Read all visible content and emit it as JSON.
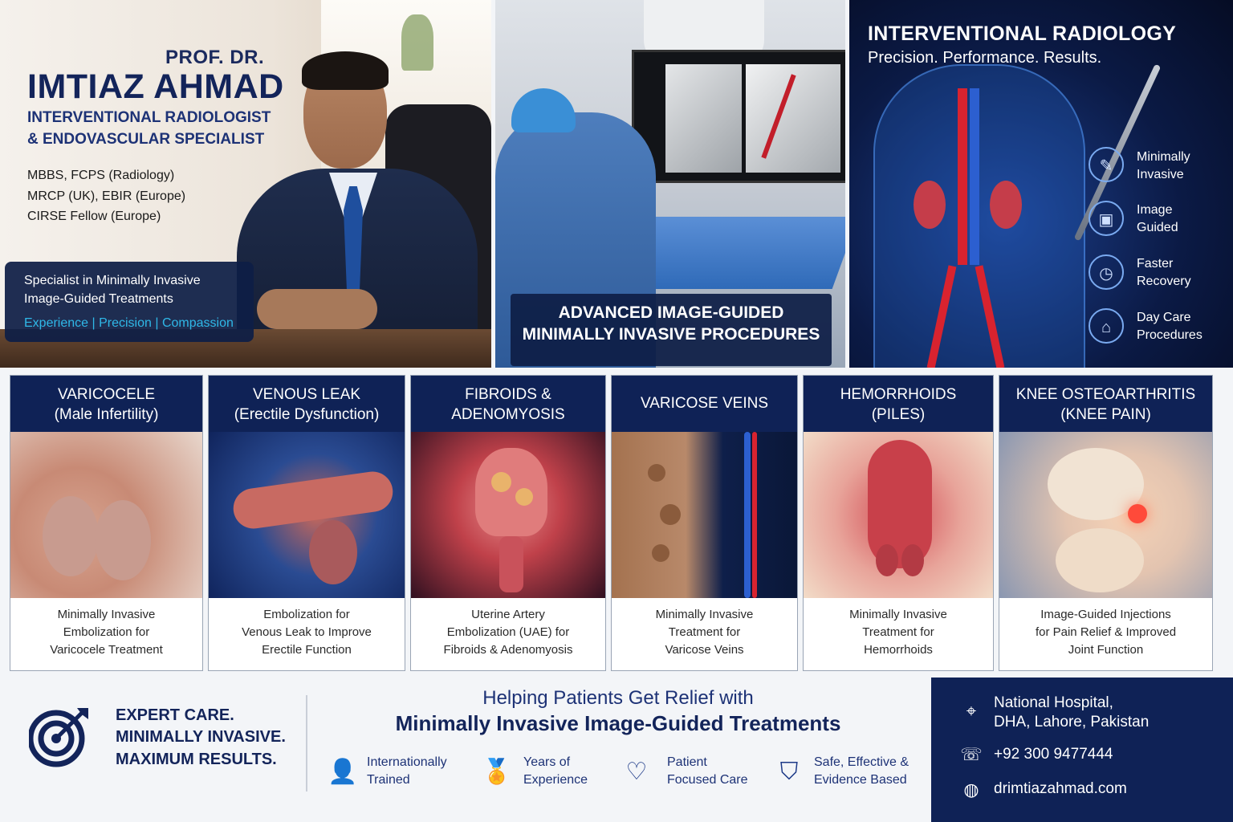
{
  "doctor": {
    "prefix": "PROF. DR.",
    "name": "IMTIAZ AHMAD",
    "role_line1": "INTERVENTIONAL RADIOLOGIST",
    "role_line2": "& ENDOVASCULAR SPECIALIST",
    "qualifications": [
      "MBBS, FCPS (Radiology)",
      "MRCP (UK), EBIR (Europe)",
      "CIRSE Fellow (Europe)"
    ],
    "specialty_line1": "Specialist in Minimally Invasive",
    "specialty_line2": "Image-Guided Treatments",
    "values": "Experience | Precision | Compassion"
  },
  "procedures_banner": {
    "line1": "ADVANCED IMAGE-GUIDED",
    "line2": "MINIMALLY INVASIVE PROCEDURES"
  },
  "ir": {
    "title": "INTERVENTIONAL RADIOLOGY",
    "subtitle": "Precision. Performance. Results.",
    "features": [
      {
        "icon": "catheter-icon",
        "glyph": "✎",
        "line1": "Minimally",
        "line2": "Invasive"
      },
      {
        "icon": "monitor-icon",
        "glyph": "▣",
        "line1": "Image",
        "line2": "Guided"
      },
      {
        "icon": "clock-icon",
        "glyph": "◷",
        "line1": "Faster",
        "line2": "Recovery"
      },
      {
        "icon": "home-icon",
        "glyph": "⌂",
        "line1": "Day Care",
        "line2": "Procedures"
      }
    ]
  },
  "cards": [
    {
      "id": "varicocele",
      "title1": "VARICOCELE",
      "title2": "(Male Infertility)",
      "cap1": "Minimally Invasive",
      "cap2": "Embolization for",
      "cap3": "Varicocele Treatment"
    },
    {
      "id": "venous",
      "title1": "VENOUS LEAK",
      "title2": "(Erectile Dysfunction)",
      "cap1": "Embolization for",
      "cap2": "Venous Leak to Improve",
      "cap3": "Erectile Function"
    },
    {
      "id": "fibroids",
      "title1": "FIBROIDS &",
      "title2": "ADENOMYOSIS",
      "cap1": "Uterine Artery",
      "cap2": "Embolization (UAE) for",
      "cap3": "Fibroids & Adenomyosis"
    },
    {
      "id": "varicose",
      "title1": "VARICOSE VEINS",
      "title2": "",
      "cap1": "Minimally Invasive",
      "cap2": "Treatment for",
      "cap3": "Varicose Veins"
    },
    {
      "id": "hemorrhoids",
      "title1": "HEMORRHOIDS",
      "title2": "(PILES)",
      "cap1": "Minimally Invasive",
      "cap2": "Treatment for",
      "cap3": "Hemorrhoids"
    },
    {
      "id": "knee",
      "title1": "KNEE OSTEOARTHRITIS",
      "title2": "(KNEE PAIN)",
      "cap1": "Image-Guided Injections",
      "cap2": "for Pain Relief & Improved",
      "cap3": "Joint Function"
    }
  ],
  "tagline": [
    "EXPERT CARE.",
    "MINIMALLY INVASIVE.",
    "MAXIMUM RESULTS."
  ],
  "help": {
    "line1": "Helping Patients Get Relief with",
    "line2": "Minimally Invasive Image-Guided Treatments"
  },
  "badges": [
    {
      "icon": "person-icon",
      "glyph": "👤",
      "line1": "Internationally",
      "line2": "Trained"
    },
    {
      "icon": "medal-icon",
      "glyph": "🏅",
      "line1": "Years of",
      "line2": "Experience"
    },
    {
      "icon": "heart-hand-icon",
      "glyph": "♡",
      "line1": "Patient",
      "line2": "Focused Care"
    },
    {
      "icon": "shield-check-icon",
      "glyph": "⛉",
      "line1": "Safe, Effective &",
      "line2": "Evidence Based"
    }
  ],
  "contact": {
    "address1": "National Hospital,",
    "address2": "DHA, Lahore, Pakistan",
    "phone": "+92 300 9477444",
    "website": "drimtiazahmad.com"
  },
  "colors": {
    "navy": "#0f2256",
    "accent": "#2fb8e8",
    "artery_red": "#d8232f",
    "vein_blue": "#2c5fd0"
  }
}
